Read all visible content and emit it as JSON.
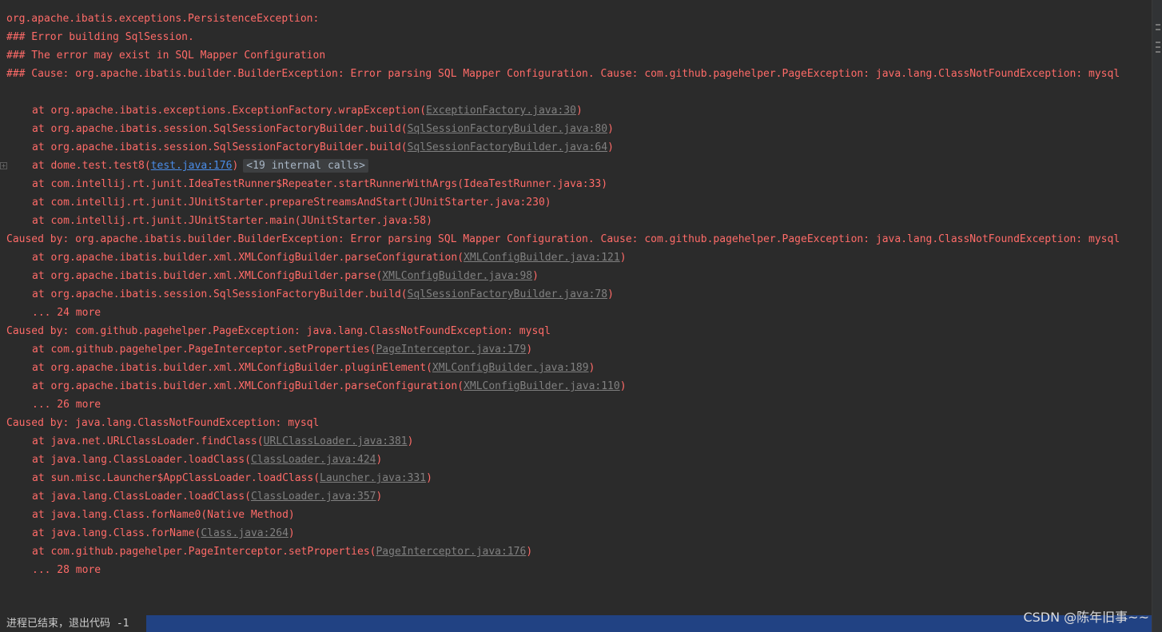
{
  "lines": {
    "l1": "org.apache.ibatis.exceptions.PersistenceException: ",
    "l2": "### Error building SqlSession.",
    "l3": "### The error may exist in SQL Mapper Configuration",
    "l4": "### Cause: org.apache.ibatis.builder.BuilderException: Error parsing SQL Mapper Configuration. Cause: com.github.pagehelper.PageException: java.lang.ClassNotFoundException: mysql",
    "s1": {
      "text": "at org.apache.ibatis.exceptions.ExceptionFactory.wrapException(",
      "link": "ExceptionFactory.java:30",
      "tail": ")"
    },
    "s2": {
      "text": "at org.apache.ibatis.session.SqlSessionFactoryBuilder.build(",
      "link": "SqlSessionFactoryBuilder.java:80",
      "tail": ")"
    },
    "s3": {
      "text": "at org.apache.ibatis.session.SqlSessionFactoryBuilder.build(",
      "link": "SqlSessionFactoryBuilder.java:64",
      "tail": ")"
    },
    "s4": {
      "text": "at dome.test.test8(",
      "link": "test.java:176",
      "tail": ")",
      "folded": "<19 internal calls>"
    },
    "s5": "at com.intellij.rt.junit.IdeaTestRunner$Repeater.startRunnerWithArgs(IdeaTestRunner.java:33)",
    "s6": "at com.intellij.rt.junit.JUnitStarter.prepareStreamsAndStart(JUnitStarter.java:230)",
    "s7": "at com.intellij.rt.junit.JUnitStarter.main(JUnitStarter.java:58)",
    "c1": "Caused by: org.apache.ibatis.builder.BuilderException: Error parsing SQL Mapper Configuration. Cause: com.github.pagehelper.PageException: java.lang.ClassNotFoundException: mysql",
    "s8": {
      "text": "at org.apache.ibatis.builder.xml.XMLConfigBuilder.parseConfiguration(",
      "link": "XMLConfigBuilder.java:121",
      "tail": ")"
    },
    "s9": {
      "text": "at org.apache.ibatis.builder.xml.XMLConfigBuilder.parse(",
      "link": "XMLConfigBuilder.java:98",
      "tail": ")"
    },
    "s10": {
      "text": "at org.apache.ibatis.session.SqlSessionFactoryBuilder.build(",
      "link": "SqlSessionFactoryBuilder.java:78",
      "tail": ")"
    },
    "m1": "... 24 more",
    "c2": "Caused by: com.github.pagehelper.PageException: java.lang.ClassNotFoundException: mysql",
    "s11": {
      "text": "at com.github.pagehelper.PageInterceptor.setProperties(",
      "link": "PageInterceptor.java:179",
      "tail": ")"
    },
    "s12": {
      "text": "at org.apache.ibatis.builder.xml.XMLConfigBuilder.pluginElement(",
      "link": "XMLConfigBuilder.java:189",
      "tail": ")"
    },
    "s13": {
      "text": "at org.apache.ibatis.builder.xml.XMLConfigBuilder.parseConfiguration(",
      "link": "XMLConfigBuilder.java:110",
      "tail": ")"
    },
    "m2": "... 26 more",
    "c3": "Caused by: java.lang.ClassNotFoundException: mysql",
    "s14": {
      "text": "at java.net.URLClassLoader.findClass(",
      "link": "URLClassLoader.java:381",
      "tail": ")"
    },
    "s15": {
      "text": "at java.lang.ClassLoader.loadClass(",
      "link": "ClassLoader.java:424",
      "tail": ")"
    },
    "s16": {
      "text": "at sun.misc.Launcher$AppClassLoader.loadClass(",
      "link": "Launcher.java:331",
      "tail": ")"
    },
    "s17": {
      "text": "at java.lang.ClassLoader.loadClass(",
      "link": "ClassLoader.java:357",
      "tail": ")"
    },
    "s18": "at java.lang.Class.forName0(Native Method)",
    "s19": {
      "text": "at java.lang.Class.forName(",
      "link": "Class.java:264",
      "tail": ")"
    },
    "s20": {
      "text": "at com.github.pagehelper.PageInterceptor.setProperties(",
      "link": "PageInterceptor.java:176",
      "tail": ")"
    },
    "m3": "... 28 more"
  },
  "status": "进程已结束，退出代码 -1",
  "watermark": "CSDN @陈年旧事~~",
  "colors": {
    "background": "#2b2b2b",
    "error_text": "#ff6b68",
    "link": "#808080",
    "project_link": "#4a8de8",
    "selection": "#214283"
  }
}
